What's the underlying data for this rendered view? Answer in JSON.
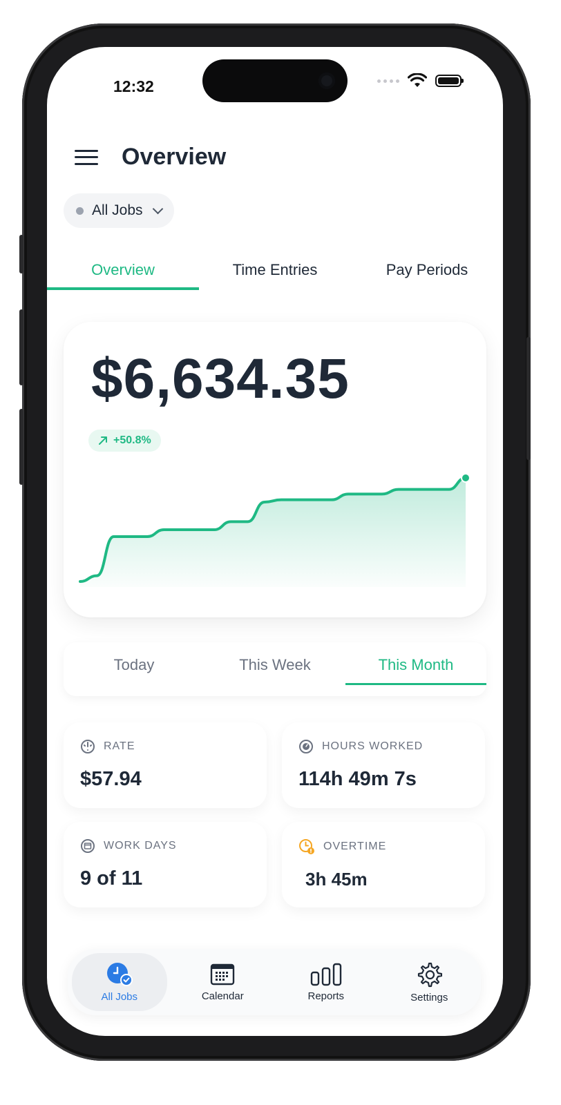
{
  "status": {
    "time": "12:32"
  },
  "header": {
    "title": "Overview"
  },
  "job_filter": {
    "label": "All Jobs"
  },
  "tabs": [
    {
      "label": "Overview",
      "active": true
    },
    {
      "label": "Time Entries",
      "active": false
    },
    {
      "label": "Pay Periods",
      "active": false
    }
  ],
  "earnings": {
    "amount": "$6,634.35",
    "change": "+50.8%",
    "accent": "#1fb984"
  },
  "chart_data": {
    "type": "area",
    "x": [
      0,
      1,
      2,
      3,
      4,
      5,
      6,
      7,
      8,
      9,
      10,
      11,
      12,
      13,
      14,
      15,
      16,
      17,
      18,
      19,
      20
    ],
    "series": [
      {
        "values": [
          0,
          0.5,
          3.9,
          3.9,
          3.9,
          4.5,
          4.5,
          4.5,
          4.5,
          5.2,
          5.2,
          6.9,
          7.1,
          7.1,
          7.1,
          7.1,
          7.6,
          7.6,
          7.6,
          8.0,
          8.0,
          8.0,
          8.0,
          9.0
        ]
      }
    ],
    "title": "",
    "xlabel": "",
    "ylabel": "",
    "grid": false,
    "legend": "none"
  },
  "periods": [
    {
      "label": "Today",
      "active": false
    },
    {
      "label": "This Week",
      "active": false
    },
    {
      "label": "This Month",
      "active": true
    }
  ],
  "stats": {
    "rate": {
      "label": "RATE",
      "value": "$57.94"
    },
    "hours": {
      "label": "HOURS WORKED",
      "value": "114h 49m 7s"
    },
    "work_days": {
      "label": "WORK DAYS",
      "value": "9 of 11"
    },
    "overtime": {
      "label": "OVERTIME",
      "value": "3h 45m",
      "icon_color": "#f5a623"
    }
  },
  "nav": [
    {
      "label": "All Jobs",
      "icon": "clock-check-icon",
      "active": true,
      "color": "#2b7be4"
    },
    {
      "label": "Calendar",
      "icon": "calendar-icon",
      "active": false
    },
    {
      "label": "Reports",
      "icon": "bar-chart-icon",
      "active": false
    },
    {
      "label": "Settings",
      "icon": "gear-icon",
      "active": false
    }
  ]
}
